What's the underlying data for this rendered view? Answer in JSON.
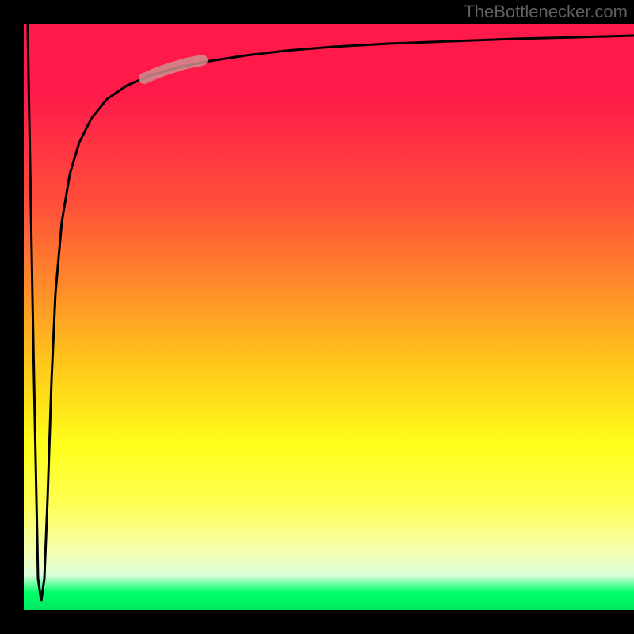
{
  "attribution": "TheBottlenecker.com",
  "chart_data": {
    "type": "line",
    "title": "",
    "xlabel": "",
    "ylabel": "",
    "xlim": [
      0,
      100
    ],
    "ylim": [
      0,
      100
    ],
    "background_gradient": {
      "top": "#ff1a4a",
      "mid1": "#ff8c2a",
      "mid2": "#ffff1a",
      "bottom": "#00e860"
    },
    "series": [
      {
        "name": "bottleneck-curve",
        "color": "#000000",
        "x": [
          0,
          1,
          2,
          2.5,
          3,
          3.5,
          4,
          5,
          6,
          7,
          8,
          10,
          12,
          15,
          18,
          20,
          22,
          25,
          30,
          35,
          40,
          50,
          60,
          70,
          80,
          90,
          100
        ],
        "y": [
          100,
          50,
          5,
          2,
          10,
          30,
          50,
          65,
          73,
          78,
          81,
          85,
          87.5,
          89.5,
          90.8,
          91.5,
          92,
          92.8,
          93.8,
          94.5,
          95,
          95.8,
          96.3,
          96.7,
          97,
          97.3,
          97.5
        ]
      },
      {
        "name": "highlight-segment",
        "color": "#d49090",
        "x": [
          20,
          22,
          25,
          28,
          30
        ],
        "y": [
          91.5,
          92,
          92.8,
          93.4,
          93.8
        ]
      }
    ]
  }
}
